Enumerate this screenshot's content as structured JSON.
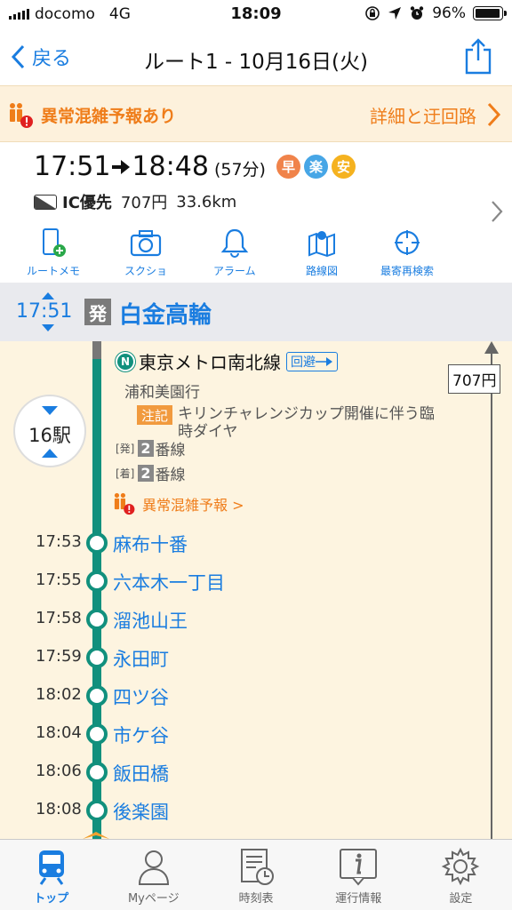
{
  "status_bar": {
    "carrier": "docomo",
    "network": "4G",
    "time": "18:09",
    "battery": "96%"
  },
  "nav": {
    "back_label": "戻る",
    "title": "ルート1 - 10月16日(火)"
  },
  "alert": {
    "label": "異常混雑予報あり",
    "detail_label": "詳細と迂回路"
  },
  "summary": {
    "depart_time": "17:51",
    "arrive_time": "18:48",
    "duration": "(57分)",
    "badges": [
      {
        "text": "早",
        "color": "#f0834a"
      },
      {
        "text": "楽",
        "color": "#47a6e6"
      },
      {
        "text": "安",
        "color": "#f5b21f"
      }
    ],
    "ic_label": "IC優先",
    "fare": "707円",
    "distance": "33.6km"
  },
  "tools": [
    {
      "label": "ルートメモ",
      "icon": "phone-plus-icon"
    },
    {
      "label": "スクショ",
      "icon": "camera-icon"
    },
    {
      "label": "アラーム",
      "icon": "bell-icon"
    },
    {
      "label": "路線図",
      "icon": "map-icon"
    },
    {
      "label": "最寄再検索",
      "icon": "crosshair-icon"
    }
  ],
  "departure": {
    "time": "17:51",
    "marker": "発",
    "station": "白金高輪"
  },
  "segment": {
    "line_mark": "N",
    "line_name": "東京メトロ南北線",
    "avoid_label": "回避",
    "destination": "浦和美園行",
    "note_tag": "注記",
    "note_text": "キリンチャレンジカップ開催に伴う臨時ダイヤ",
    "dep_track_label": "[発]",
    "dep_track_num": "2",
    "arr_track_label": "[着]",
    "arr_track_num": "2",
    "track_suffix": "番線",
    "congestion_label": "異常混雑予報 >",
    "station_count": "16駅",
    "fare_box": "707円"
  },
  "stops": [
    {
      "time": "17:53",
      "name": "麻布十番"
    },
    {
      "time": "17:55",
      "name": "六本木一丁目"
    },
    {
      "time": "17:58",
      "name": "溜池山王"
    },
    {
      "time": "17:59",
      "name": "永田町"
    },
    {
      "time": "18:02",
      "name": "四ツ谷"
    },
    {
      "time": "18:04",
      "name": "市ケ谷"
    },
    {
      "time": "18:06",
      "name": "飯田橋"
    },
    {
      "time": "18:08",
      "name": "後楽園"
    }
  ],
  "tabs": [
    {
      "label": "トップ",
      "icon": "train-icon",
      "active": true
    },
    {
      "label": "Myページ",
      "icon": "person-icon",
      "active": false
    },
    {
      "label": "時刻表",
      "icon": "timetable-icon",
      "active": false
    },
    {
      "label": "運行情報",
      "icon": "info-icon",
      "active": false
    },
    {
      "label": "設定",
      "icon": "gear-icon",
      "active": false
    }
  ]
}
